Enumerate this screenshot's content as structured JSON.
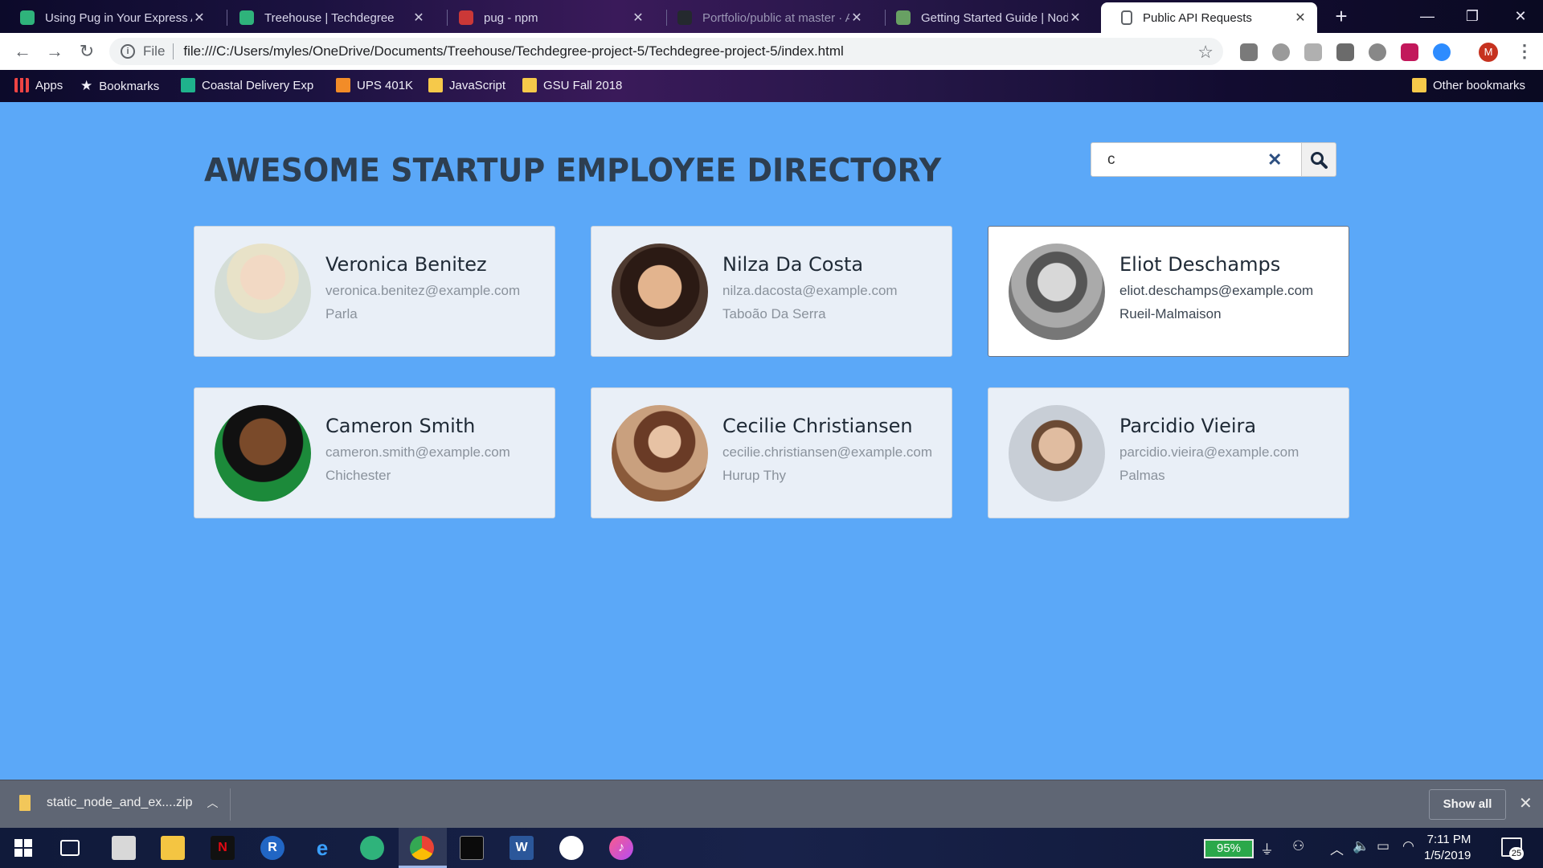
{
  "browser": {
    "tabs": [
      {
        "title": "Using Pug in Your Express Ap",
        "favicon_color": "#2fb37b"
      },
      {
        "title": "Treehouse | Techdegree",
        "favicon_color": "#2fb37b"
      },
      {
        "title": "pug - npm",
        "favicon_color": "#cb3837"
      },
      {
        "title": "Portfolio/public at master · A",
        "favicon_color": "#24292e"
      },
      {
        "title": "Getting Started Guide | Node",
        "favicon_color": "#68a063"
      },
      {
        "title": "Public API Requests",
        "favicon_color": "#5f6368",
        "active": true
      }
    ],
    "address": {
      "scheme": "File",
      "url": "file:///C:/Users/myles/OneDrive/Documents/Treehouse/Techdegree-project-5/Techdegree-project-5/index.html"
    },
    "profile_initial": "M",
    "bookmarks": [
      {
        "label": "Apps",
        "icon": "apps-grid-icon"
      },
      {
        "label": "Bookmarks",
        "icon": "star-icon"
      },
      {
        "label": "Coastal Delivery Expr",
        "icon": "coastal-icon"
      },
      {
        "label": "UPS 401K",
        "icon": "folder-icon"
      },
      {
        "label": "JavaScript",
        "icon": "folder-icon"
      },
      {
        "label": "GSU Fall 2018",
        "icon": "folder-icon"
      }
    ],
    "other_bookmarks": "Other bookmarks"
  },
  "page": {
    "title": "AWESOME STARTUP EMPLOYEE DIRECTORY",
    "search": {
      "value": "c",
      "clear_icon": "close-icon",
      "button_icon": "search-icon"
    },
    "employees": [
      {
        "name": "Veronica Benitez",
        "email": "veronica.benitez@example.com",
        "city": "Parla",
        "avatar_color": "#cfd8d0"
      },
      {
        "name": "Nilza Da Costa",
        "email": "nilza.dacosta@example.com",
        "city": "Taboão Da Serra",
        "avatar_color": "#6b4a3a"
      },
      {
        "name": "Eliot Deschamps",
        "email": "eliot.deschamps@example.com",
        "city": "Rueil-Malmaison",
        "avatar_color": "#8a8a8a",
        "hover": true
      },
      {
        "name": "Cameron Smith",
        "email": "cameron.smith@example.com",
        "city": "Chichester",
        "avatar_color": "#1e2a1c"
      },
      {
        "name": "Cecilie Christiansen",
        "email": "cecilie.christiansen@example.com",
        "city": "Hurup Thy",
        "avatar_color": "#9b6a4e"
      },
      {
        "name": "Parcidio Vieira",
        "email": "parcidio.vieira@example.com",
        "city": "Palmas",
        "avatar_color": "#b8c0c8"
      }
    ]
  },
  "downloads": {
    "file": "static_node_and_ex....zip",
    "show_all": "Show all"
  },
  "taskbar": {
    "battery": "95%",
    "time": "7:11 PM",
    "date": "1/5/2019",
    "notifications": "25"
  },
  "colors": {
    "page_bg": "#5ba8f8",
    "title": "#2d3e50",
    "card_bg": "#e9eff7"
  }
}
